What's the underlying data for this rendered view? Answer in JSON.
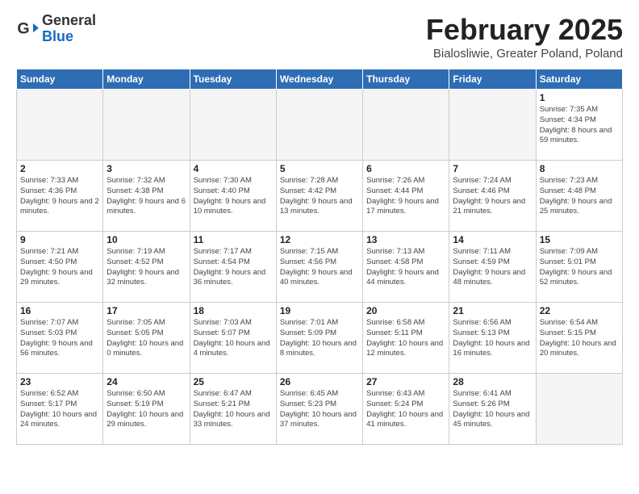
{
  "logo": {
    "general": "General",
    "blue": "Blue"
  },
  "title": "February 2025",
  "subtitle": "Bialosliwie, Greater Poland, Poland",
  "days_header": [
    "Sunday",
    "Monday",
    "Tuesday",
    "Wednesday",
    "Thursday",
    "Friday",
    "Saturday"
  ],
  "weeks": [
    [
      {
        "day": "",
        "info": ""
      },
      {
        "day": "",
        "info": ""
      },
      {
        "day": "",
        "info": ""
      },
      {
        "day": "",
        "info": ""
      },
      {
        "day": "",
        "info": ""
      },
      {
        "day": "",
        "info": ""
      },
      {
        "day": "1",
        "info": "Sunrise: 7:35 AM\nSunset: 4:34 PM\nDaylight: 8 hours and 59 minutes."
      }
    ],
    [
      {
        "day": "2",
        "info": "Sunrise: 7:33 AM\nSunset: 4:36 PM\nDaylight: 9 hours and 2 minutes."
      },
      {
        "day": "3",
        "info": "Sunrise: 7:32 AM\nSunset: 4:38 PM\nDaylight: 9 hours and 6 minutes."
      },
      {
        "day": "4",
        "info": "Sunrise: 7:30 AM\nSunset: 4:40 PM\nDaylight: 9 hours and 10 minutes."
      },
      {
        "day": "5",
        "info": "Sunrise: 7:28 AM\nSunset: 4:42 PM\nDaylight: 9 hours and 13 minutes."
      },
      {
        "day": "6",
        "info": "Sunrise: 7:26 AM\nSunset: 4:44 PM\nDaylight: 9 hours and 17 minutes."
      },
      {
        "day": "7",
        "info": "Sunrise: 7:24 AM\nSunset: 4:46 PM\nDaylight: 9 hours and 21 minutes."
      },
      {
        "day": "8",
        "info": "Sunrise: 7:23 AM\nSunset: 4:48 PM\nDaylight: 9 hours and 25 minutes."
      }
    ],
    [
      {
        "day": "9",
        "info": "Sunrise: 7:21 AM\nSunset: 4:50 PM\nDaylight: 9 hours and 29 minutes."
      },
      {
        "day": "10",
        "info": "Sunrise: 7:19 AM\nSunset: 4:52 PM\nDaylight: 9 hours and 32 minutes."
      },
      {
        "day": "11",
        "info": "Sunrise: 7:17 AM\nSunset: 4:54 PM\nDaylight: 9 hours and 36 minutes."
      },
      {
        "day": "12",
        "info": "Sunrise: 7:15 AM\nSunset: 4:56 PM\nDaylight: 9 hours and 40 minutes."
      },
      {
        "day": "13",
        "info": "Sunrise: 7:13 AM\nSunset: 4:58 PM\nDaylight: 9 hours and 44 minutes."
      },
      {
        "day": "14",
        "info": "Sunrise: 7:11 AM\nSunset: 4:59 PM\nDaylight: 9 hours and 48 minutes."
      },
      {
        "day": "15",
        "info": "Sunrise: 7:09 AM\nSunset: 5:01 PM\nDaylight: 9 hours and 52 minutes."
      }
    ],
    [
      {
        "day": "16",
        "info": "Sunrise: 7:07 AM\nSunset: 5:03 PM\nDaylight: 9 hours and 56 minutes."
      },
      {
        "day": "17",
        "info": "Sunrise: 7:05 AM\nSunset: 5:05 PM\nDaylight: 10 hours and 0 minutes."
      },
      {
        "day": "18",
        "info": "Sunrise: 7:03 AM\nSunset: 5:07 PM\nDaylight: 10 hours and 4 minutes."
      },
      {
        "day": "19",
        "info": "Sunrise: 7:01 AM\nSunset: 5:09 PM\nDaylight: 10 hours and 8 minutes."
      },
      {
        "day": "20",
        "info": "Sunrise: 6:58 AM\nSunset: 5:11 PM\nDaylight: 10 hours and 12 minutes."
      },
      {
        "day": "21",
        "info": "Sunrise: 6:56 AM\nSunset: 5:13 PM\nDaylight: 10 hours and 16 minutes."
      },
      {
        "day": "22",
        "info": "Sunrise: 6:54 AM\nSunset: 5:15 PM\nDaylight: 10 hours and 20 minutes."
      }
    ],
    [
      {
        "day": "23",
        "info": "Sunrise: 6:52 AM\nSunset: 5:17 PM\nDaylight: 10 hours and 24 minutes."
      },
      {
        "day": "24",
        "info": "Sunrise: 6:50 AM\nSunset: 5:19 PM\nDaylight: 10 hours and 29 minutes."
      },
      {
        "day": "25",
        "info": "Sunrise: 6:47 AM\nSunset: 5:21 PM\nDaylight: 10 hours and 33 minutes."
      },
      {
        "day": "26",
        "info": "Sunrise: 6:45 AM\nSunset: 5:23 PM\nDaylight: 10 hours and 37 minutes."
      },
      {
        "day": "27",
        "info": "Sunrise: 6:43 AM\nSunset: 5:24 PM\nDaylight: 10 hours and 41 minutes."
      },
      {
        "day": "28",
        "info": "Sunrise: 6:41 AM\nSunset: 5:26 PM\nDaylight: 10 hours and 45 minutes."
      },
      {
        "day": "",
        "info": ""
      }
    ]
  ]
}
